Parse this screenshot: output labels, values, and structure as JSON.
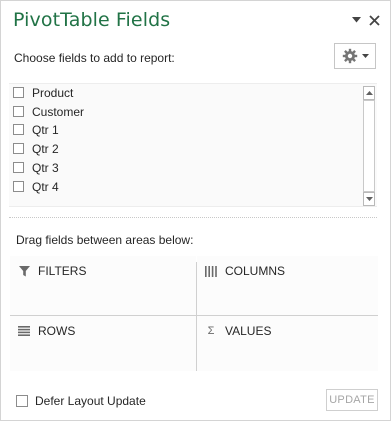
{
  "pane": {
    "title": "PivotTable Fields",
    "chevron_icon": "chevron-down-icon",
    "close_icon": "close-x-icon",
    "choose_label": "Choose fields to add to report:",
    "tools_icon": "gear-icon"
  },
  "fields": [
    {
      "label": "Product",
      "checked": false
    },
    {
      "label": "Customer",
      "checked": false
    },
    {
      "label": "Qtr 1",
      "checked": false
    },
    {
      "label": "Qtr 2",
      "checked": false
    },
    {
      "label": "Qtr 3",
      "checked": false
    },
    {
      "label": "Qtr 4",
      "checked": false
    }
  ],
  "areas_section": {
    "label": "Drag fields between areas below:",
    "filters": {
      "label": "FILTERS",
      "icon": "filter-icon"
    },
    "columns": {
      "label": "COLUMNS",
      "icon": "columns-icon"
    },
    "rows": {
      "label": "ROWS",
      "icon": "rows-icon"
    },
    "values": {
      "label": "VALUES",
      "icon": "sigma-icon",
      "glyph": "Σ"
    }
  },
  "footer": {
    "defer_label": "Defer Layout Update",
    "defer_checked": false,
    "update_label": "UPDATE",
    "update_enabled": false
  },
  "colors": {
    "title": "#217346",
    "border": "#d4d4d4",
    "disabled_text": "#a6a6a6"
  }
}
